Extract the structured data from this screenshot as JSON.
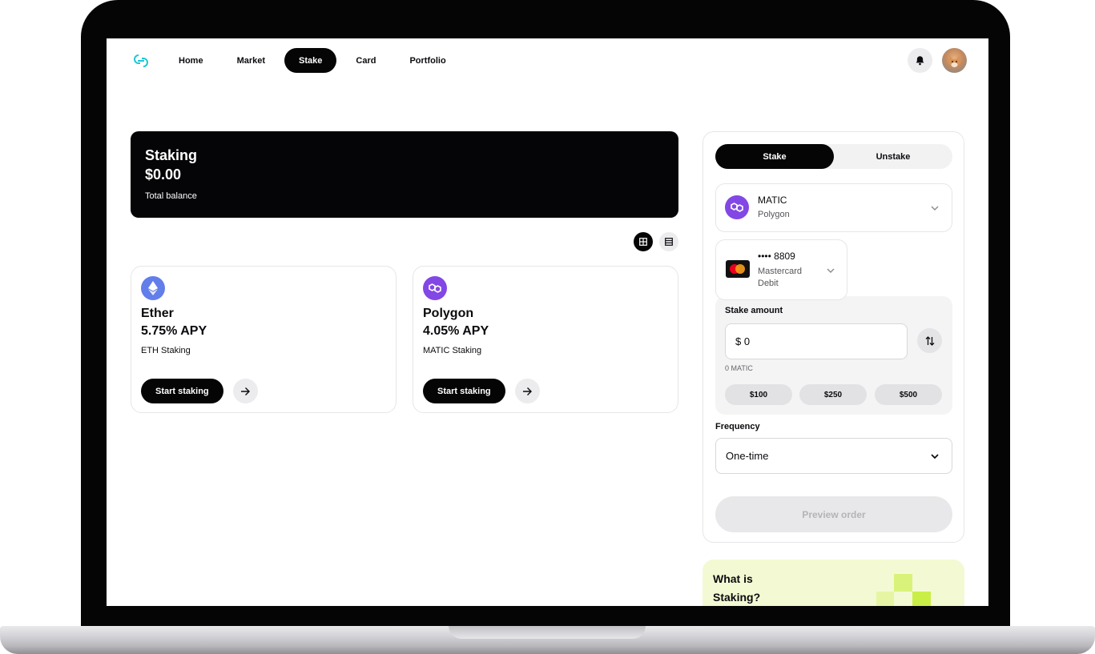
{
  "nav": {
    "items": [
      "Home",
      "Market",
      "Stake",
      "Card",
      "Portfolio"
    ],
    "active": "Stake"
  },
  "icons": {
    "logo": "link-rings-logo-icon",
    "notifications": "bell-icon",
    "grid_view": "grid-view-icon",
    "list_view": "list-view-icon",
    "arrow": "arrow-right-icon",
    "swap": "swap-vertical-icon",
    "chevron": "chevron-down-icon"
  },
  "balance_card": {
    "title": "Staking",
    "amount": "$0.00",
    "caption": "Total balance"
  },
  "assets": [
    {
      "name": "Ether",
      "apy": "5.75% APY",
      "subtitle": "ETH Staking",
      "button": "Start staking",
      "icon": "ethereum-icon",
      "color": "#627eea"
    },
    {
      "name": "Polygon",
      "apy": "4.05% APY",
      "subtitle": "MATIC Staking",
      "button": "Start staking",
      "icon": "polygon-icon",
      "color": "#8247e5"
    }
  ],
  "stake_panel": {
    "tabs": [
      "Stake",
      "Unstake"
    ],
    "active_tab": "Stake",
    "asset": {
      "symbol": "MATIC",
      "network": "Polygon"
    },
    "payment": {
      "number": "•••• 8809",
      "brand": "Mastercard",
      "type": "Debit"
    },
    "amount_label": "Stake amount",
    "amount_value": "$ 0",
    "amount_converted": "0 MATIC",
    "quick_amounts": [
      "$100",
      "$250",
      "$500"
    ],
    "frequency_label": "Frequency",
    "frequency_value": "One-time",
    "preview_button": "Preview order"
  },
  "promo": {
    "title": "What is Staking?"
  },
  "colors": {
    "accent": "#050505",
    "promo_bg": "#f3fad3",
    "promo_pixels": "#d9f27a",
    "logo": "#1fc7d4"
  }
}
